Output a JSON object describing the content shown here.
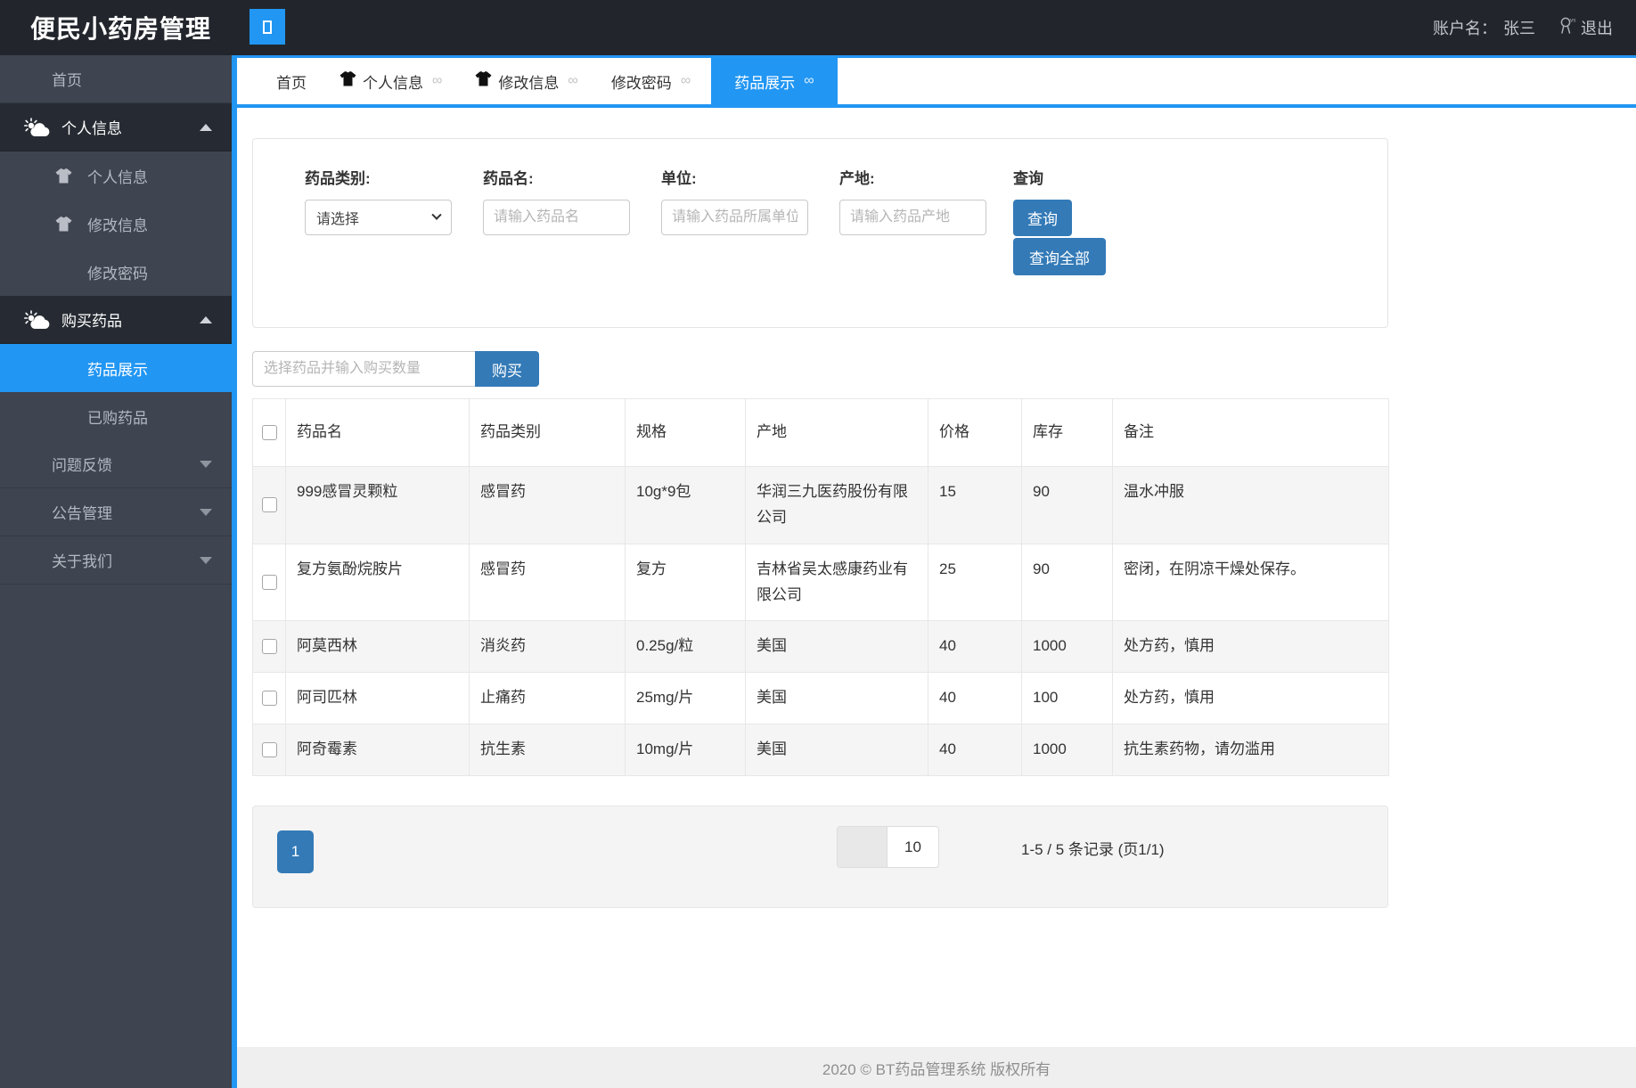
{
  "header": {
    "title": "便民小药房管理",
    "account_label": "账户名：",
    "account_name": "张三",
    "logout_label": "退出"
  },
  "sidebar": {
    "items": [
      {
        "label": "首页",
        "type": "link"
      },
      {
        "label": "个人信息",
        "type": "group",
        "icon": "weather-icon",
        "caret": "up"
      },
      {
        "label": "个人信息",
        "type": "sub",
        "icon": "tshirt-icon"
      },
      {
        "label": "修改信息",
        "type": "sub",
        "icon": "tshirt-icon"
      },
      {
        "label": "修改密码",
        "type": "sub"
      },
      {
        "label": "购买药品",
        "type": "group",
        "icon": "weather-icon",
        "caret": "up"
      },
      {
        "label": "药品展示",
        "type": "sub",
        "active": true
      },
      {
        "label": "已购药品",
        "type": "sub"
      },
      {
        "label": "问题反馈",
        "type": "collapsed",
        "caret": "down"
      },
      {
        "label": "公告管理",
        "type": "collapsed",
        "caret": "down"
      },
      {
        "label": "关于我们",
        "type": "collapsed",
        "caret": "down"
      }
    ]
  },
  "tab_bar": {
    "close_glyph": "∞",
    "tabs": [
      {
        "label": "首页",
        "icon": null,
        "closable": false,
        "active": false
      },
      {
        "label": "个人信息",
        "icon": "tshirt-icon",
        "closable": true,
        "active": false
      },
      {
        "label": "修改信息",
        "icon": "tshirt-icon",
        "closable": true,
        "active": false
      },
      {
        "label": "修改密码",
        "icon": null,
        "closable": true,
        "active": false
      },
      {
        "label": "药品展示",
        "icon": null,
        "closable": true,
        "active": true
      }
    ]
  },
  "filters": {
    "category": {
      "label": "药品类别:",
      "value": "请选择"
    },
    "name": {
      "label": "药品名:",
      "placeholder": "请输入药品名"
    },
    "unit": {
      "label": "单位:",
      "placeholder": "请输入药品所属单位"
    },
    "origin": {
      "label": "产地:",
      "placeholder": "请输入药品产地"
    },
    "query_label": "查询",
    "query_button": "查询",
    "query_all_button": "查询全部"
  },
  "purchase": {
    "placeholder": "选择药品并输入购买数量",
    "button": "购买"
  },
  "table": {
    "headers": [
      "药品名",
      "药品类别",
      "规格",
      "产地",
      "价格",
      "库存",
      "备注"
    ],
    "rows": [
      [
        "999感冒灵颗粒",
        "感冒药",
        "10g*9包",
        "华润三九医药股份有限公司",
        "15",
        "90",
        "温水冲服"
      ],
      [
        "复方氨酚烷胺片",
        "感冒药",
        "复方",
        "吉林省吴太感康药业有限公司",
        "25",
        "90",
        "密闭，在阴凉干燥处保存。"
      ],
      [
        "阿莫西林",
        "消炎药",
        "0.25g/粒",
        "美国",
        "40",
        "1000",
        "处方药，慎用"
      ],
      [
        "阿司匹林",
        "止痛药",
        "25mg/片",
        "美国",
        "40",
        "100",
        "处方药，慎用"
      ],
      [
        "阿奇霉素",
        "抗生素",
        "10mg/片",
        "美国",
        "40",
        "1000",
        "抗生素药物，请勿滥用"
      ]
    ]
  },
  "pagination": {
    "page": "1",
    "page_size": "10",
    "summary": "1-5 / 5 条记录 (页1/1)"
  },
  "footer": {
    "copyright": "2020 © BT药品管理系统 版权所有"
  },
  "colors": {
    "accent": "#2196f3",
    "button": "#337ab7",
    "header_bg": "#22262c",
    "sidebar_bg": "#3e4450"
  }
}
